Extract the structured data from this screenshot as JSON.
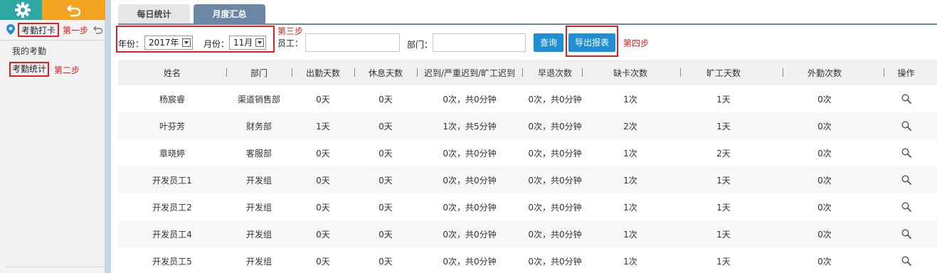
{
  "sidebar": {
    "punch_label": "考勤打卡",
    "step1": "第一步",
    "my_attendance": "我的考勤",
    "attendance_stats": "考勤统计",
    "step2": "第二步"
  },
  "tabs": [
    {
      "label": "每日统计",
      "active": false
    },
    {
      "label": "月度汇总",
      "active": true
    }
  ],
  "filters": {
    "year_label": "年份：",
    "year_value": "2017年",
    "month_label": "月份：",
    "month_value": "11月",
    "step3": "第三步",
    "employee_label": "员工：",
    "employee_value": "",
    "dept_label": "部门：",
    "dept_value": "",
    "query_label": "查询",
    "export_label": "导出报表",
    "step4": "第四步"
  },
  "table": {
    "headers": [
      "姓名",
      "部门",
      "出勤天数",
      "休息天数",
      "迟到/严重迟到/旷工迟到",
      "早退次数",
      "缺卡次数",
      "旷工天数",
      "外勤次数",
      "操作"
    ],
    "rows": [
      [
        "杨宸睿",
        "渠道销售部",
        "0天",
        "0天",
        "0次，共0分钟",
        "0次，共0分钟",
        "1次",
        "1天",
        "0次"
      ],
      [
        "叶芬芳",
        "财务部",
        "1天",
        "0天",
        "1次，共5分钟",
        "0次，共0分钟",
        "2次",
        "1天",
        "0次"
      ],
      [
        "章晓婷",
        "客服部",
        "0天",
        "0天",
        "0次，共0分钟",
        "0次，共0分钟",
        "1次",
        "2天",
        "0次"
      ],
      [
        "开发员工1",
        "开发组",
        "0天",
        "0天",
        "0次，共0分钟",
        "0次，共0分钟",
        "1次",
        "1天",
        "0次"
      ],
      [
        "开发员工2",
        "开发组",
        "0天",
        "0天",
        "0次，共0分钟",
        "0次，共0分钟",
        "1次",
        "1天",
        "0次"
      ],
      [
        "开发员工4",
        "开发组",
        "0天",
        "0天",
        "0次，共0分钟",
        "0次，共0分钟",
        "1次",
        "1天",
        "0次"
      ],
      [
        "开发员工5",
        "开发组",
        "0天",
        "0天",
        "0次，共0分钟",
        "0次，共0分钟",
        "1次",
        "1天",
        "0次"
      ]
    ]
  },
  "colors": {
    "accent_teal": "#2ea8a5",
    "accent_orange": "#f4a321",
    "tab_active": "#6c86a6",
    "button_blue": "#1e8ed6",
    "annotation_red": "#e02020"
  },
  "icons": {
    "settings": "gear-icon",
    "back": "back-arrow-icon",
    "location": "location-pin-icon",
    "undo": "undo-icon",
    "view": "search-icon"
  }
}
